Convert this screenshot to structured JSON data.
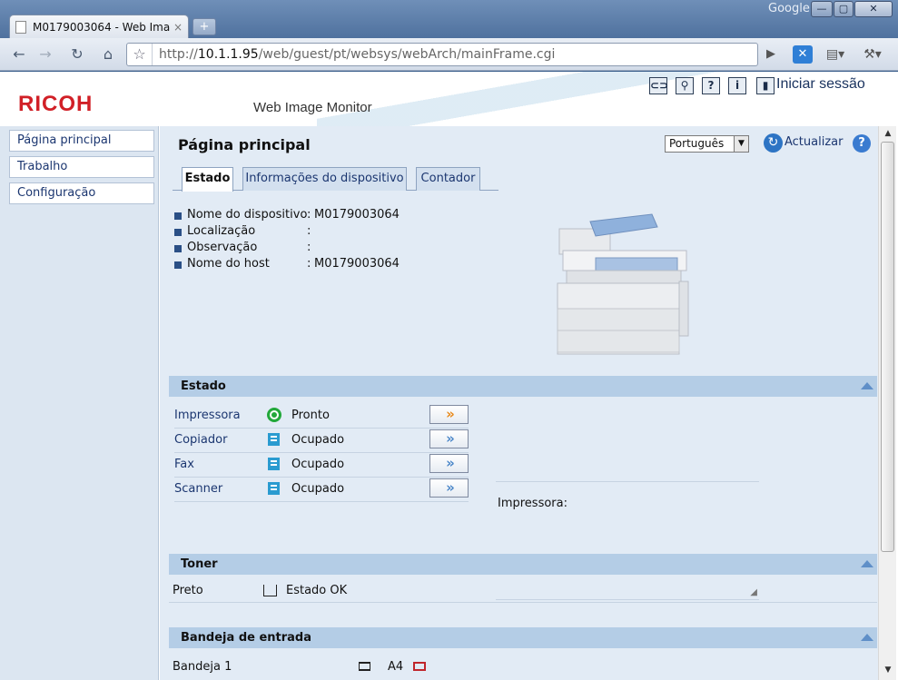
{
  "browser": {
    "tab_title": "M0179003064 - Web Ima...",
    "tab_close": "×",
    "new_tab": "+",
    "brand": "Google",
    "url_prefix": "http://",
    "url_host": "10.1.1.95",
    "url_path": "/web/guest/pt/websys/webArch/mainFrame.cgi"
  },
  "header": {
    "logo": "RICOH",
    "product": "Web Image Monitor",
    "help_q": "?",
    "info_i": "i",
    "login": "Iniciar sessão"
  },
  "sidebar": {
    "items": [
      {
        "label": "Página principal"
      },
      {
        "label": "Trabalho"
      },
      {
        "label": "Configuração"
      }
    ]
  },
  "main": {
    "title": "Página principal",
    "language": "Português",
    "refresh": "Actualizar",
    "help": "?",
    "tabs": [
      {
        "label": "Estado",
        "active": true
      },
      {
        "label": "Informações do dispositivo",
        "active": false
      },
      {
        "label": "Contador",
        "active": false
      }
    ],
    "info": [
      {
        "label": "Nome do dispositivo",
        "sep": ":",
        "value": "M0179003064"
      },
      {
        "label": "Localização",
        "sep": ":",
        "value": ""
      },
      {
        "label": "Observação",
        "sep": ":",
        "value": ""
      },
      {
        "label": "Nome do host",
        "sep": ":",
        "value": "M0179003064"
      }
    ]
  },
  "estado": {
    "title": "Estado",
    "rows": [
      {
        "device": "Impressora",
        "status": "Pronto",
        "icon": "ready-icon",
        "go": "»"
      },
      {
        "device": "Copiador",
        "status": "Ocupado",
        "icon": "busy-icon",
        "go": "»"
      },
      {
        "device": "Fax",
        "status": "Ocupado",
        "icon": "busy-icon",
        "go": "»"
      },
      {
        "device": "Scanner",
        "status": "Ocupado",
        "icon": "busy-icon",
        "go": "»"
      }
    ],
    "detail_label": "Impressora:"
  },
  "toner": {
    "title": "Toner",
    "color": "Preto",
    "status": "Estado OK"
  },
  "input_tray": {
    "title": "Bandeja de entrada",
    "tray": "Bandeja 1",
    "paper": "A4"
  },
  "colors": {
    "ricoh_red": "#d12027",
    "section_bar": "#b4cde6",
    "main_bg": "#e2ebf5",
    "sidebar_bg": "#dce6f1",
    "link_blue": "#1b3670",
    "ready_green": "#22a83a",
    "go_orange": "#e8891a",
    "go_blue": "#4a86c8"
  }
}
